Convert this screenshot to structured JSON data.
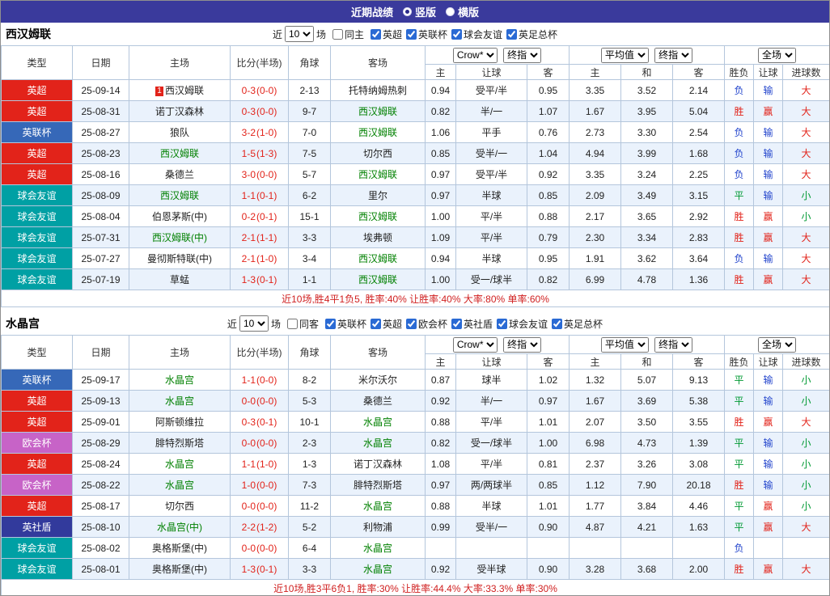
{
  "header": {
    "title": "近期战绩",
    "layout_options": [
      {
        "label": "竖版",
        "selected": true
      },
      {
        "label": "横版",
        "selected": false
      }
    ]
  },
  "league_colors": {
    "英超": "#e2231a",
    "英联杯": "#3668b8",
    "球会友谊": "#00a0a4",
    "欧会杯": "#c763c7",
    "英社盾": "#323a9c"
  },
  "result_colors": {
    "胜": "#e2231a",
    "赢": "#e2231a",
    "大": "#e2231a",
    "平": "#009933",
    "小": "#009933",
    "负": "#2244cc",
    "输": "#2244cc"
  },
  "team_highlight_color": "#008000",
  "sections": [
    {
      "team": "西汉姆联",
      "filter": {
        "prefix": "近",
        "count": "10",
        "suffix": "场",
        "venue": {
          "label": "同主",
          "checked": false
        },
        "leagues": [
          {
            "label": "英超",
            "checked": true
          },
          {
            "label": "英联杯",
            "checked": true
          },
          {
            "label": "球会友谊",
            "checked": true
          },
          {
            "label": "英足总杯",
            "checked": true
          }
        ]
      },
      "table": {
        "col_headers": [
          "类型",
          "日期",
          "主场",
          "比分(半场)",
          "角球",
          "客场"
        ],
        "dropdowns": {
          "company": "Crow*",
          "company_time": "终指",
          "average": "平均值",
          "average_time": "终指",
          "scope": "全场"
        },
        "sub_headers": [
          "主",
          "让球",
          "客",
          "主",
          "和",
          "客",
          "胜负",
          "让球",
          "进球数"
        ],
        "rows": [
          {
            "type": "英超",
            "date": "25-09-14",
            "home": "西汉姆联",
            "home_badge": "1",
            "score": "0-3",
            "half": "(0-0)",
            "corner": "2-13",
            "away": "托特纳姆热刺",
            "odds": [
              "0.94",
              "受平/半",
              "0.95"
            ],
            "avg": [
              "3.35",
              "3.52",
              "2.14"
            ],
            "results": [
              "负",
              "输",
              "大"
            ]
          },
          {
            "type": "英超",
            "date": "25-08-31",
            "home": "诺丁汉森林",
            "score": "0-3",
            "half": "(0-0)",
            "corner": "9-7",
            "away": "西汉姆联",
            "away_self": true,
            "odds": [
              "0.82",
              "半/一",
              "1.07"
            ],
            "avg": [
              "1.67",
              "3.95",
              "5.04"
            ],
            "results": [
              "胜",
              "赢",
              "大"
            ]
          },
          {
            "type": "英联杯",
            "date": "25-08-27",
            "home": "狼队",
            "score": "3-2",
            "half": "(1-0)",
            "corner": "7-0",
            "away": "西汉姆联",
            "away_self": true,
            "odds": [
              "1.06",
              "平手",
              "0.76"
            ],
            "avg": [
              "2.73",
              "3.30",
              "2.54"
            ],
            "results": [
              "负",
              "输",
              "大"
            ]
          },
          {
            "type": "英超",
            "date": "25-08-23",
            "home": "西汉姆联",
            "home_self": true,
            "score": "1-5",
            "half": "(1-3)",
            "corner": "7-5",
            "away": "切尔西",
            "odds": [
              "0.85",
              "受半/一",
              "1.04"
            ],
            "avg": [
              "4.94",
              "3.99",
              "1.68"
            ],
            "results": [
              "负",
              "输",
              "大"
            ]
          },
          {
            "type": "英超",
            "date": "25-08-16",
            "home": "桑德兰",
            "score": "3-0",
            "half": "(0-0)",
            "corner": "5-7",
            "away": "西汉姆联",
            "away_self": true,
            "odds": [
              "0.97",
              "受平/半",
              "0.92"
            ],
            "avg": [
              "3.35",
              "3.24",
              "2.25"
            ],
            "results": [
              "负",
              "输",
              "大"
            ]
          },
          {
            "type": "球会友谊",
            "date": "25-08-09",
            "home": "西汉姆联",
            "home_self": true,
            "score": "1-1",
            "half": "(0-1)",
            "corner": "6-2",
            "away": "里尔",
            "odds": [
              "0.97",
              "半球",
              "0.85"
            ],
            "avg": [
              "2.09",
              "3.49",
              "3.15"
            ],
            "results": [
              "平",
              "输",
              "小"
            ]
          },
          {
            "type": "球会友谊",
            "date": "25-08-04",
            "home": "伯恩茅斯(中)",
            "score": "0-2",
            "half": "(0-1)",
            "corner": "15-1",
            "away": "西汉姆联",
            "away_self": true,
            "odds": [
              "1.00",
              "平/半",
              "0.88"
            ],
            "avg": [
              "2.17",
              "3.65",
              "2.92"
            ],
            "results": [
              "胜",
              "赢",
              "小"
            ]
          },
          {
            "type": "球会友谊",
            "date": "25-07-31",
            "home": "西汉姆联(中)",
            "home_self": true,
            "score": "2-1",
            "half": "(1-1)",
            "corner": "3-3",
            "away": "埃弗顿",
            "odds": [
              "1.09",
              "平/半",
              "0.79"
            ],
            "avg": [
              "2.30",
              "3.34",
              "2.83"
            ],
            "results": [
              "胜",
              "赢",
              "大"
            ]
          },
          {
            "type": "球会友谊",
            "date": "25-07-27",
            "home": "曼彻斯特联(中)",
            "score": "2-1",
            "half": "(1-0)",
            "corner": "3-4",
            "away": "西汉姆联",
            "away_self": true,
            "odds": [
              "0.94",
              "半球",
              "0.95"
            ],
            "avg": [
              "1.91",
              "3.62",
              "3.64"
            ],
            "results": [
              "负",
              "输",
              "大"
            ]
          },
          {
            "type": "球会友谊",
            "date": "25-07-19",
            "home": "草蜢",
            "score": "1-3",
            "half": "(0-1)",
            "corner": "1-1",
            "away": "西汉姆联",
            "away_self": true,
            "odds": [
              "1.00",
              "受一/球半",
              "0.82"
            ],
            "avg": [
              "6.99",
              "4.78",
              "1.36"
            ],
            "results": [
              "胜",
              "赢",
              "大"
            ]
          }
        ],
        "summary": "近10场,胜4平1负5, 胜率:40% 让胜率:40% 大率:80% 单率:60%"
      }
    },
    {
      "team": "水晶宫",
      "filter": {
        "prefix": "近",
        "count": "10",
        "suffix": "场",
        "venue": {
          "label": "同客",
          "checked": false
        },
        "leagues": [
          {
            "label": "英联杯",
            "checked": true
          },
          {
            "label": "英超",
            "checked": true
          },
          {
            "label": "欧会杯",
            "checked": true
          },
          {
            "label": "英社盾",
            "checked": true
          },
          {
            "label": "球会友谊",
            "checked": true
          },
          {
            "label": "英足总杯",
            "checked": true
          }
        ]
      },
      "table": {
        "col_headers": [
          "类型",
          "日期",
          "主场",
          "比分(半场)",
          "角球",
          "客场"
        ],
        "dropdowns": {
          "company": "Crow*",
          "company_time": "终指",
          "average": "平均值",
          "average_time": "终指",
          "scope": "全场"
        },
        "sub_headers": [
          "主",
          "让球",
          "客",
          "主",
          "和",
          "客",
          "胜负",
          "让球",
          "进球数"
        ],
        "rows": [
          {
            "type": "英联杯",
            "date": "25-09-17",
            "home": "水晶宫",
            "home_self": true,
            "score": "1-1",
            "half": "(0-0)",
            "corner": "8-2",
            "away": "米尔沃尔",
            "odds": [
              "0.87",
              "球半",
              "1.02"
            ],
            "avg": [
              "1.32",
              "5.07",
              "9.13"
            ],
            "results": [
              "平",
              "输",
              "小"
            ]
          },
          {
            "type": "英超",
            "date": "25-09-13",
            "home": "水晶宫",
            "home_self": true,
            "score": "0-0",
            "half": "(0-0)",
            "corner": "5-3",
            "away": "桑德兰",
            "odds": [
              "0.92",
              "半/一",
              "0.97"
            ],
            "avg": [
              "1.67",
              "3.69",
              "5.38"
            ],
            "results": [
              "平",
              "输",
              "小"
            ]
          },
          {
            "type": "英超",
            "date": "25-09-01",
            "home": "阿斯顿维拉",
            "score": "0-3",
            "half": "(0-1)",
            "corner": "10-1",
            "away": "水晶宫",
            "away_self": true,
            "odds": [
              "0.88",
              "平/半",
              "1.01"
            ],
            "avg": [
              "2.07",
              "3.50",
              "3.55"
            ],
            "results": [
              "胜",
              "赢",
              "大"
            ]
          },
          {
            "type": "欧会杯",
            "date": "25-08-29",
            "home": "腓特烈斯塔",
            "score": "0-0",
            "half": "(0-0)",
            "corner": "2-3",
            "away": "水晶宫",
            "away_self": true,
            "odds": [
              "0.82",
              "受一/球半",
              "1.00"
            ],
            "avg": [
              "6.98",
              "4.73",
              "1.39"
            ],
            "results": [
              "平",
              "输",
              "小"
            ]
          },
          {
            "type": "英超",
            "date": "25-08-24",
            "home": "水晶宫",
            "home_self": true,
            "score": "1-1",
            "half": "(1-0)",
            "corner": "1-3",
            "away": "诺丁汉森林",
            "odds": [
              "1.08",
              "平/半",
              "0.81"
            ],
            "avg": [
              "2.37",
              "3.26",
              "3.08"
            ],
            "results": [
              "平",
              "输",
              "小"
            ]
          },
          {
            "type": "欧会杯",
            "date": "25-08-22",
            "home": "水晶宫",
            "home_self": true,
            "score": "1-0",
            "half": "(0-0)",
            "corner": "7-3",
            "away": "腓特烈斯塔",
            "odds": [
              "0.97",
              "两/两球半",
              "0.85"
            ],
            "avg": [
              "1.12",
              "7.90",
              "20.18"
            ],
            "results": [
              "胜",
              "输",
              "小"
            ]
          },
          {
            "type": "英超",
            "date": "25-08-17",
            "home": "切尔西",
            "score": "0-0",
            "half": "(0-0)",
            "corner": "11-2",
            "away": "水晶宫",
            "away_self": true,
            "odds": [
              "0.88",
              "半球",
              "1.01"
            ],
            "avg": [
              "1.77",
              "3.84",
              "4.46"
            ],
            "results": [
              "平",
              "赢",
              "小"
            ]
          },
          {
            "type": "英社盾",
            "date": "25-08-10",
            "home": "水晶宫(中)",
            "home_self": true,
            "score": "2-2",
            "half": "(1-2)",
            "corner": "5-2",
            "away": "利物浦",
            "odds": [
              "0.99",
              "受半/一",
              "0.90"
            ],
            "avg": [
              "4.87",
              "4.21",
              "1.63"
            ],
            "results": [
              "平",
              "赢",
              "大"
            ]
          },
          {
            "type": "球会友谊",
            "date": "25-08-02",
            "home": "奥格斯堡(中)",
            "score": "0-0",
            "half": "(0-0)",
            "corner": "6-4",
            "away": "水晶宫",
            "away_self": true,
            "odds": [
              "",
              "",
              ""
            ],
            "avg": [
              "",
              "",
              ""
            ],
            "results": [
              "负",
              "",
              ""
            ]
          },
          {
            "type": "球会友谊",
            "date": "25-08-01",
            "home": "奥格斯堡(中)",
            "score": "1-3",
            "half": "(0-1)",
            "corner": "3-3",
            "away": "水晶宫",
            "away_self": true,
            "odds": [
              "0.92",
              "受半球",
              "0.90"
            ],
            "avg": [
              "3.28",
              "3.68",
              "2.00"
            ],
            "results": [
              "胜",
              "赢",
              "大"
            ]
          }
        ],
        "summary": "近10场,胜3平6负1, 胜率:30% 让胜率:44.4% 大率:33.3% 单率:30%"
      }
    }
  ]
}
